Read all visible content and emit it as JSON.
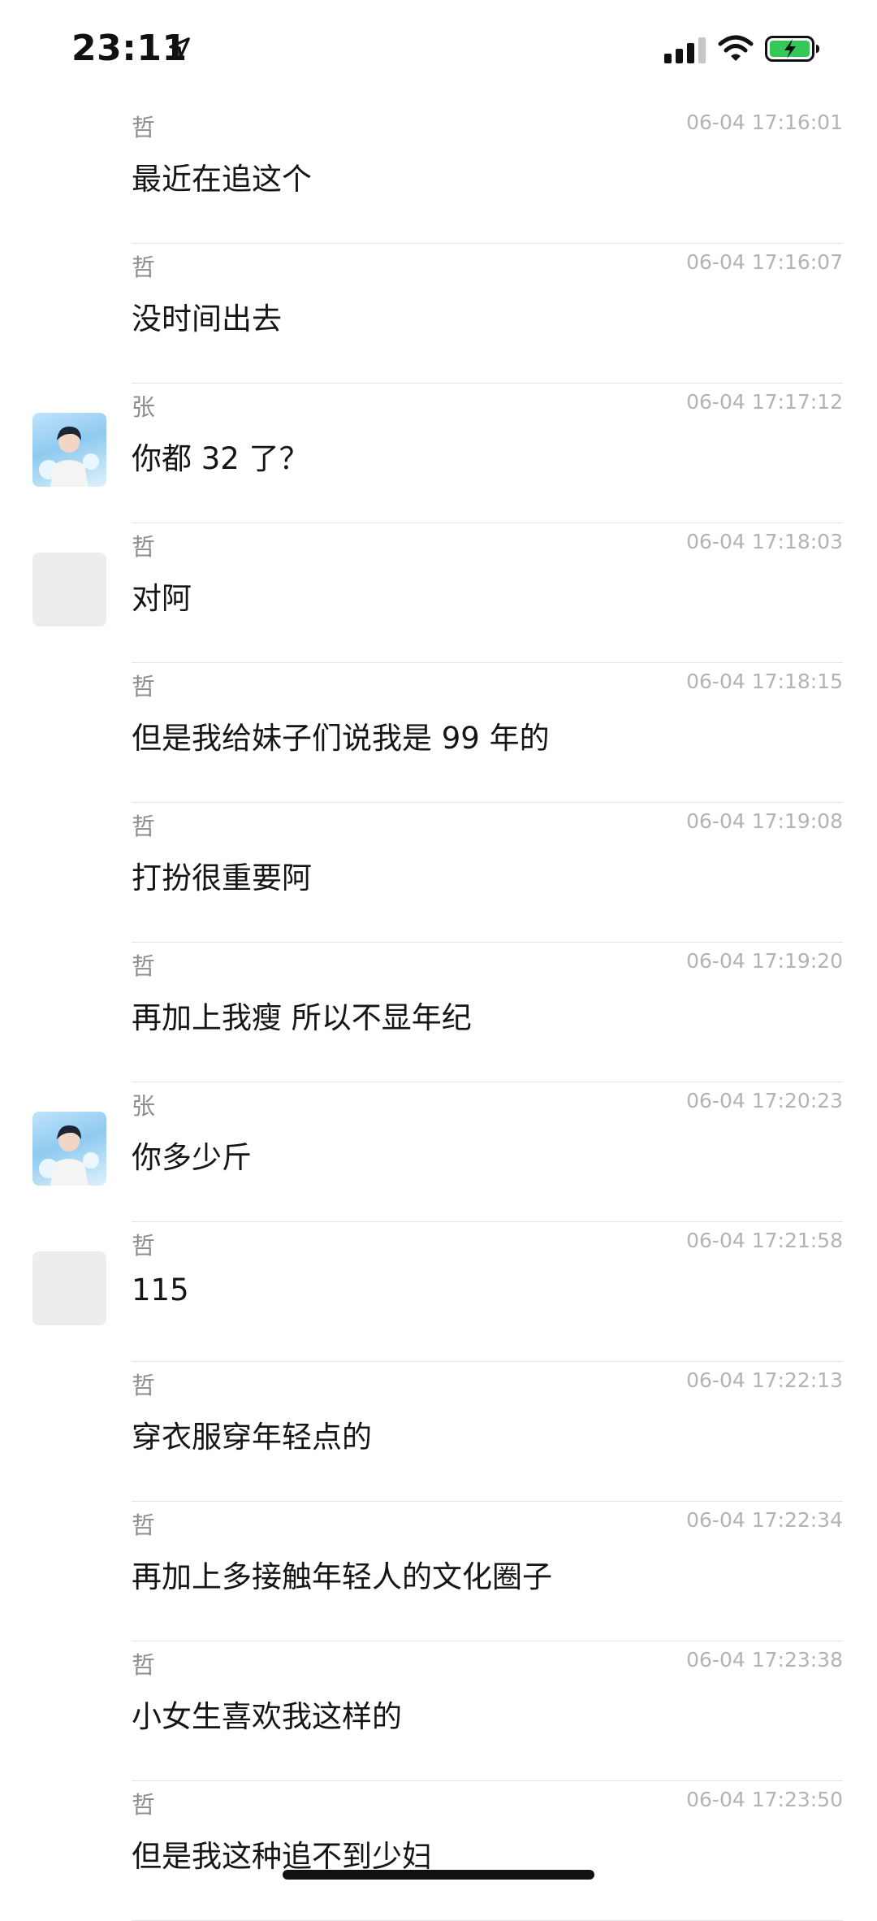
{
  "status_bar": {
    "time": "23:11",
    "location_icon": "location-arrow-icon",
    "signal_icon": "cellular-signal-icon",
    "wifi_icon": "wifi-icon",
    "battery_icon": "battery-charging-icon",
    "battery_color": "#34c759"
  },
  "messages": [
    {
      "sender": "哲",
      "timestamp": "06-04 17:16:01",
      "text": "最近在追这个",
      "avatar": "none"
    },
    {
      "sender": "哲",
      "timestamp": "06-04 17:16:07",
      "text": "没时间出去",
      "avatar": "none"
    },
    {
      "sender": "张",
      "timestamp": "06-04 17:17:12",
      "text": "你都 32 了？",
      "avatar": "photo"
    },
    {
      "sender": "哲",
      "timestamp": "06-04 17:18:03",
      "text": "对阿",
      "avatar": "blank"
    },
    {
      "sender": "哲",
      "timestamp": "06-04 17:18:15",
      "text": "但是我给妹子们说我是 99 年的",
      "avatar": "none"
    },
    {
      "sender": "哲",
      "timestamp": "06-04 17:19:08",
      "text": "打扮很重要阿",
      "avatar": "none"
    },
    {
      "sender": "哲",
      "timestamp": "06-04 17:19:20",
      "text": "再加上我瘦 所以不显年纪",
      "avatar": "none"
    },
    {
      "sender": "张",
      "timestamp": "06-04 17:20:23",
      "text": "你多少斤",
      "avatar": "photo"
    },
    {
      "sender": "哲",
      "timestamp": "06-04 17:21:58",
      "text": "115",
      "avatar": "blank"
    },
    {
      "sender": "哲",
      "timestamp": "06-04 17:22:13",
      "text": "穿衣服穿年轻点的",
      "avatar": "none"
    },
    {
      "sender": "哲",
      "timestamp": "06-04 17:22:34",
      "text": "再加上多接触年轻人的文化圈子",
      "avatar": "none"
    },
    {
      "sender": "哲",
      "timestamp": "06-04 17:23:38",
      "text": "小女生喜欢我这样的",
      "avatar": "none"
    },
    {
      "sender": "哲",
      "timestamp": "06-04 17:23:50",
      "text": "但是我这种追不到少妇",
      "avatar": "none"
    }
  ]
}
